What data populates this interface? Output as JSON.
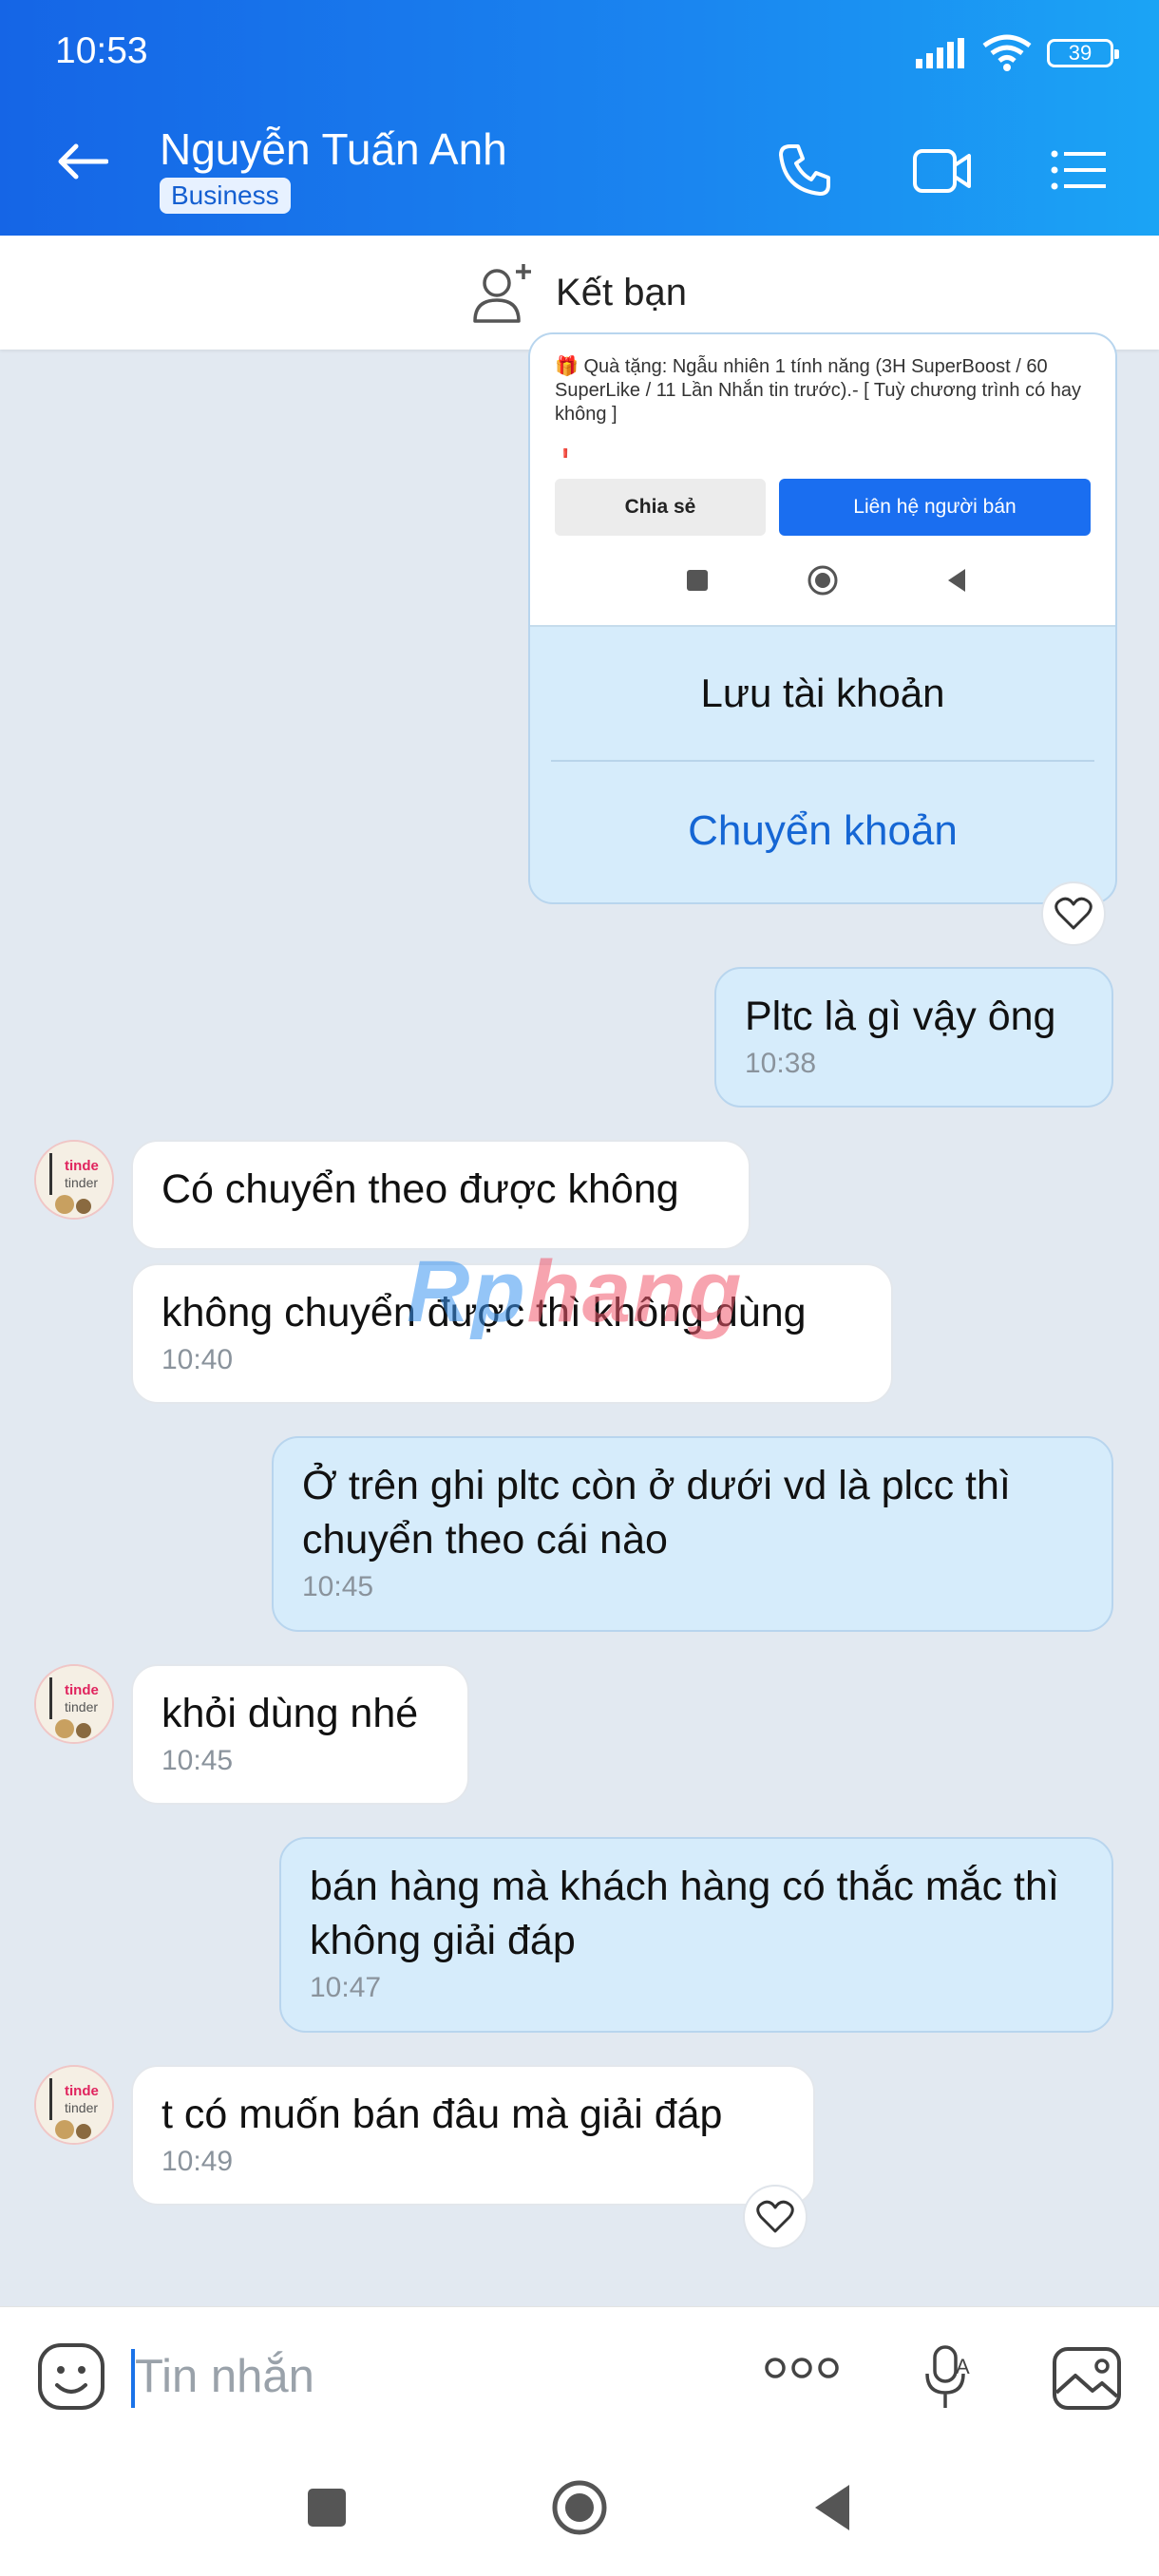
{
  "status_bar": {
    "time": "10:53",
    "battery": "39"
  },
  "header": {
    "contact_name": "Nguyễn Tuấn Anh",
    "badge": "Business",
    "colors": {
      "gradient_start": "#1565e6",
      "gradient_end": "#1ba4f5"
    },
    "icons": [
      "back-arrow-icon",
      "phone-icon",
      "video-call-icon",
      "menu-icon"
    ]
  },
  "add_friend": {
    "label": "Kết bạn",
    "icon": "add-user-icon"
  },
  "shared_card": {
    "preview_text": "🎁 Quà tặng: Ngẫu nhiên 1 tính năng (3H SuperBoost / 60 SuperLike / 11 Lần Nhắn tin trước).- [ Tuỳ chương trình có hay không ]",
    "share_button": "Chia sẻ",
    "contact_seller_button": "Liên hệ người bán",
    "save_account": "Lưu tài khoản",
    "transfer": "Chuyển khoản"
  },
  "messages": [
    {
      "direction": "out",
      "text": "Pltc là gì vậy ông",
      "time": "10:38"
    },
    {
      "direction": "in",
      "text": "Có chuyển theo được không",
      "time": ""
    },
    {
      "direction": "in",
      "text": "không chuyển được thì không dùng",
      "time": "10:40"
    },
    {
      "direction": "out",
      "text": "Ở trên ghi pltc còn ở dưới vd là plcc thì chuyển theo cái nào",
      "time": "10:45"
    },
    {
      "direction": "in",
      "text": "khỏi dùng nhé",
      "time": "10:45"
    },
    {
      "direction": "out",
      "text": "bán hàng mà khách hàng có thắc mắc thì không giải đáp",
      "time": "10:47"
    },
    {
      "direction": "in",
      "text": "t có muốn bán đâu mà giải đáp",
      "time": "10:49"
    }
  ],
  "avatar_text": [
    "tinde",
    "tinder"
  ],
  "watermark": {
    "part1": "Rp",
    "part2": "hang"
  },
  "composer": {
    "placeholder": "Tin nhắn",
    "icons": [
      "emoji-icon",
      "more-icon",
      "voice-icon",
      "image-icon"
    ]
  },
  "colors": {
    "chat_background": "#e2e9f1",
    "outgoing_bubble": "#d6ecfb",
    "incoming_bubble": "#ffffff",
    "accent": "#1566d4"
  }
}
